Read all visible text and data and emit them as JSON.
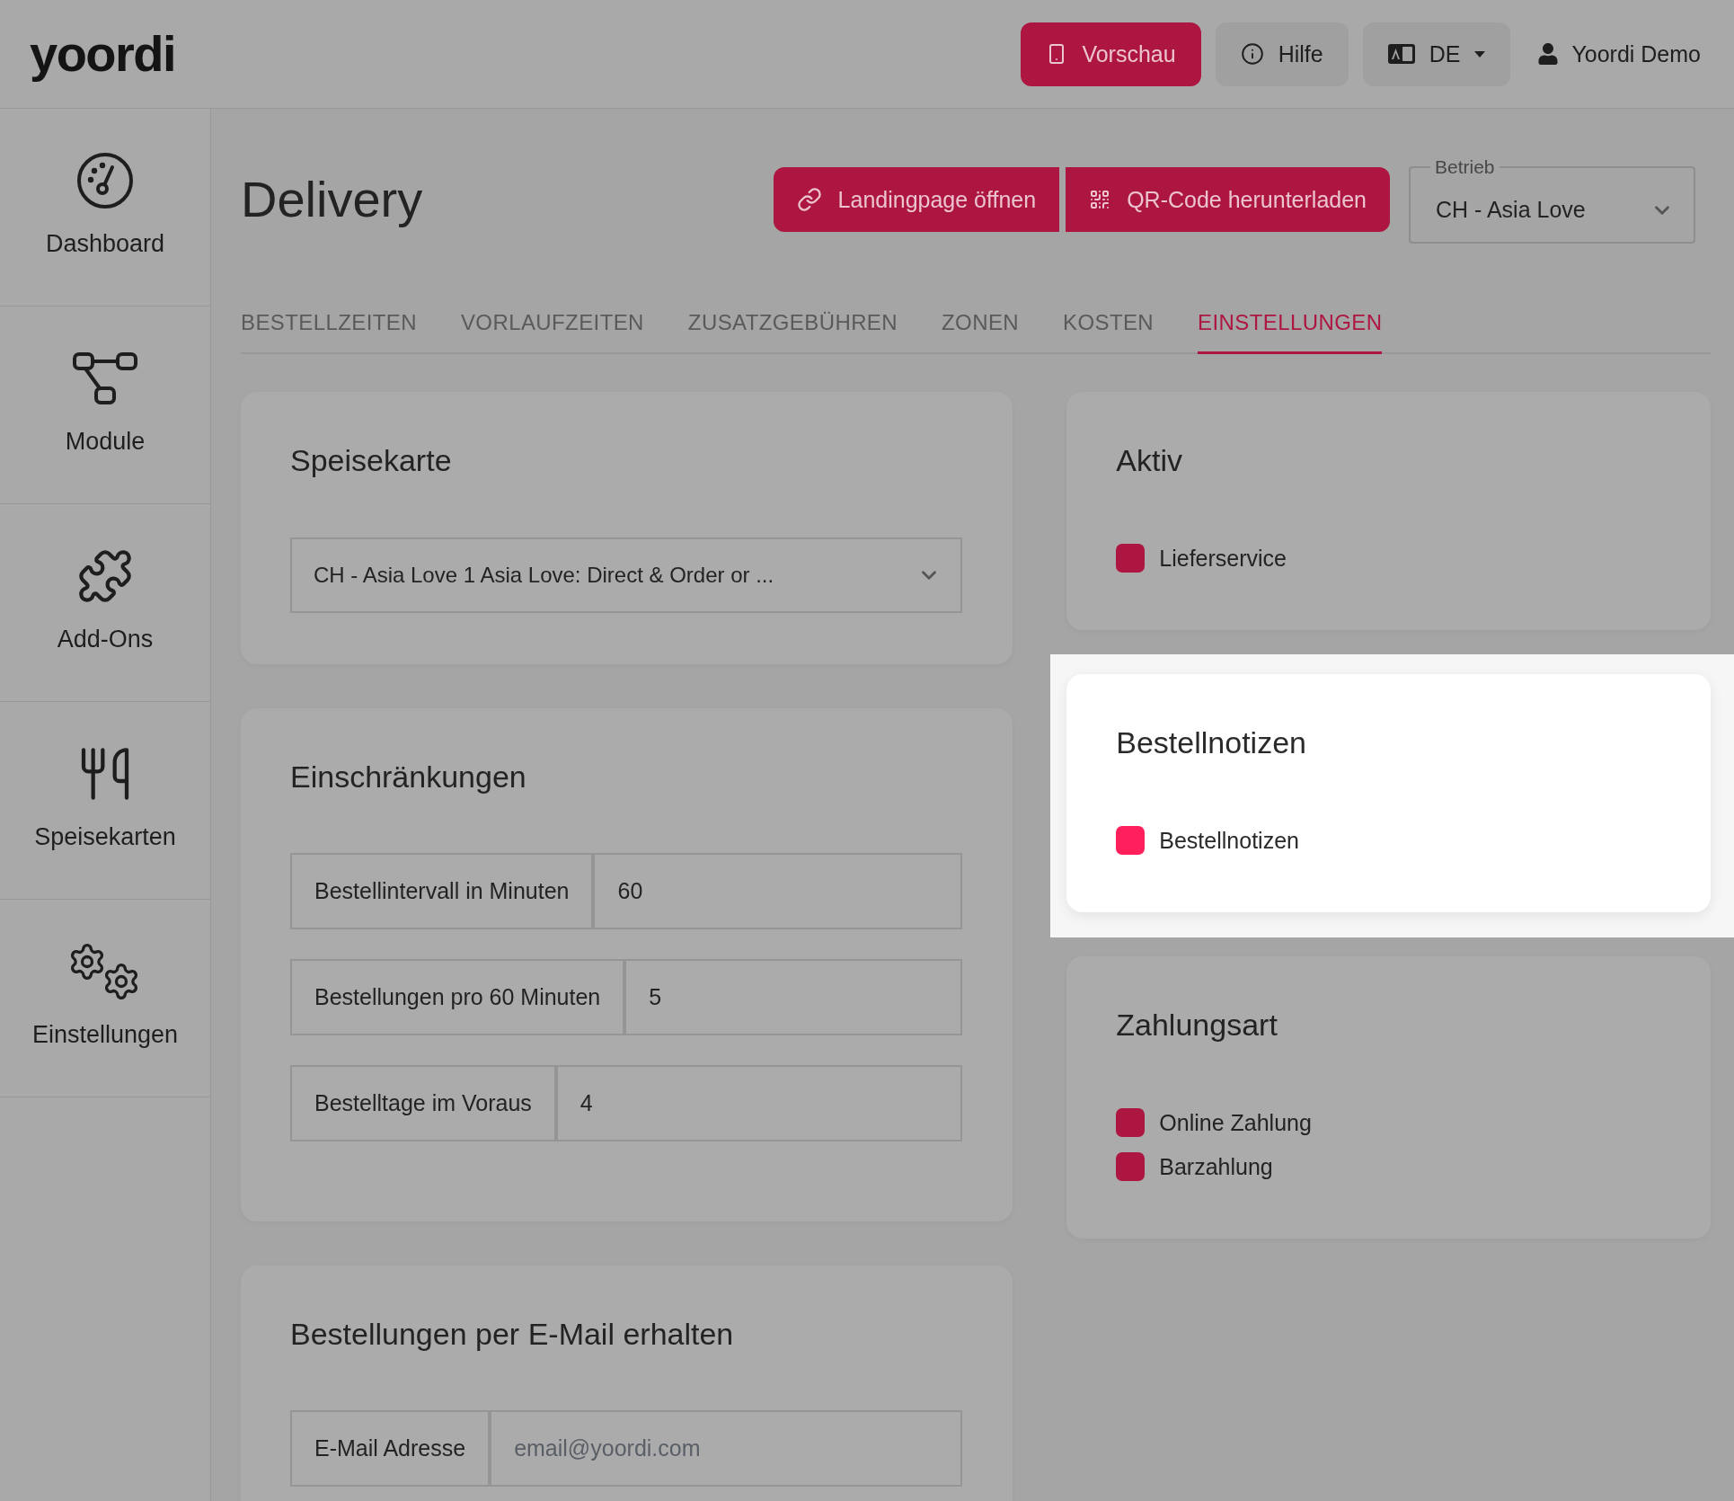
{
  "header": {
    "logo": "yoordi",
    "buttons": [
      {
        "kind": "primary",
        "label": "Vorschau"
      },
      {
        "kind": "secondary",
        "label": "Hilfe"
      },
      {
        "kind": "dropdown",
        "label": "DE"
      }
    ],
    "user": {
      "name": "Yoordi Demo"
    }
  },
  "sidebar": {
    "items": [
      {
        "label": "Dashboard",
        "selected": false
      },
      {
        "label": "Module",
        "selected": false
      },
      {
        "label": "Add-Ons",
        "selected": false
      },
      {
        "label": "Speisekarten",
        "selected": false
      },
      {
        "label": "Einstellungen",
        "selected": false
      }
    ]
  },
  "page": {
    "title": "Delivery",
    "actions": [
      {
        "label": "Landingpage öffnen"
      },
      {
        "label": "QR-Code herunterladen"
      }
    ],
    "location_select": {
      "label": "Betrieb",
      "value": "CH - Asia Love"
    }
  },
  "tabs": [
    {
      "label": "BESTELLZEITEN",
      "selected": false
    },
    {
      "label": "VORLAUFZEITEN",
      "selected": false
    },
    {
      "label": "ZUSATZGEBÜHREN",
      "selected": false
    },
    {
      "label": "ZONEN",
      "selected": false
    },
    {
      "label": "KOSTEN",
      "selected": false
    },
    {
      "label": "EINSTELLUNGEN",
      "selected": true
    }
  ],
  "left_cards": [
    {
      "kind": "select",
      "title": "Speisekarte",
      "highlighted": false,
      "select": {
        "value": "CH - Asia Love 1 Asia Love: Direct & Order or ..."
      }
    },
    {
      "kind": "inputs",
      "title": "Einschränkungen",
      "highlighted": false,
      "fields": [
        {
          "label": "Bestellintervall in Minuten",
          "value": "60"
        },
        {
          "label": "Bestellungen pro 60 Minuten",
          "value": "5"
        },
        {
          "label": "Bestelltage im Voraus",
          "value": "4"
        }
      ]
    },
    {
      "kind": "inputs",
      "title": "Bestellungen per E-Mail erhalten",
      "highlighted": false,
      "fields": [
        {
          "label": "E-Mail Adresse",
          "placeholder": "email@yoordi.com"
        }
      ]
    }
  ],
  "right_cards": [
    {
      "kind": "checkboxes",
      "title": "Aktiv",
      "highlighted": false,
      "options": [
        {
          "label": "Lieferservice",
          "checked": true
        }
      ]
    },
    {
      "kind": "checkboxes",
      "title": "Bestellnotizen",
      "highlighted": true,
      "options": [
        {
          "label": "Bestellnotizen",
          "checked": true
        }
      ]
    },
    {
      "kind": "checkboxes",
      "title": "Zahlungsart",
      "highlighted": false,
      "options": [
        {
          "label": "Online Zahlung",
          "checked": true
        },
        {
          "label": "Barzahlung",
          "checked": true
        }
      ]
    }
  ]
}
